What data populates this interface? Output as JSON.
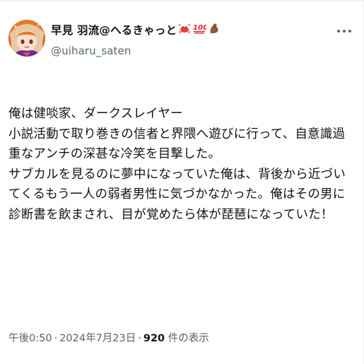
{
  "tweet": {
    "display_name": "早見 羽流@へるきゃっと",
    "name_badges": [
      "crab-emoji",
      "100-emoji",
      "flexed-biceps-emoji"
    ],
    "handle": "@uiharu_saten",
    "body_lines": [
      "俺は健啖家、ダークスレイヤー",
      "小説活動で取り巻きの信者と界隈へ遊びに行って、自意識過重なアンチの深甚な冷笑を目撃した。",
      "サブカルを見るのに夢中になっていた俺は、背後から近づいてくるもう一人の弱者男性に気づかなかった。俺はその男に診断書を飲まされ、目が覚めたら体が琵琶になっていた！"
    ],
    "time": "午後0:50",
    "date": "2024年7月23日",
    "views_count": "920",
    "views_label": "件の表示",
    "separator": "·"
  },
  "colors": {
    "text": "#0f1419",
    "secondary": "#536471",
    "border": "#eef1f3"
  }
}
